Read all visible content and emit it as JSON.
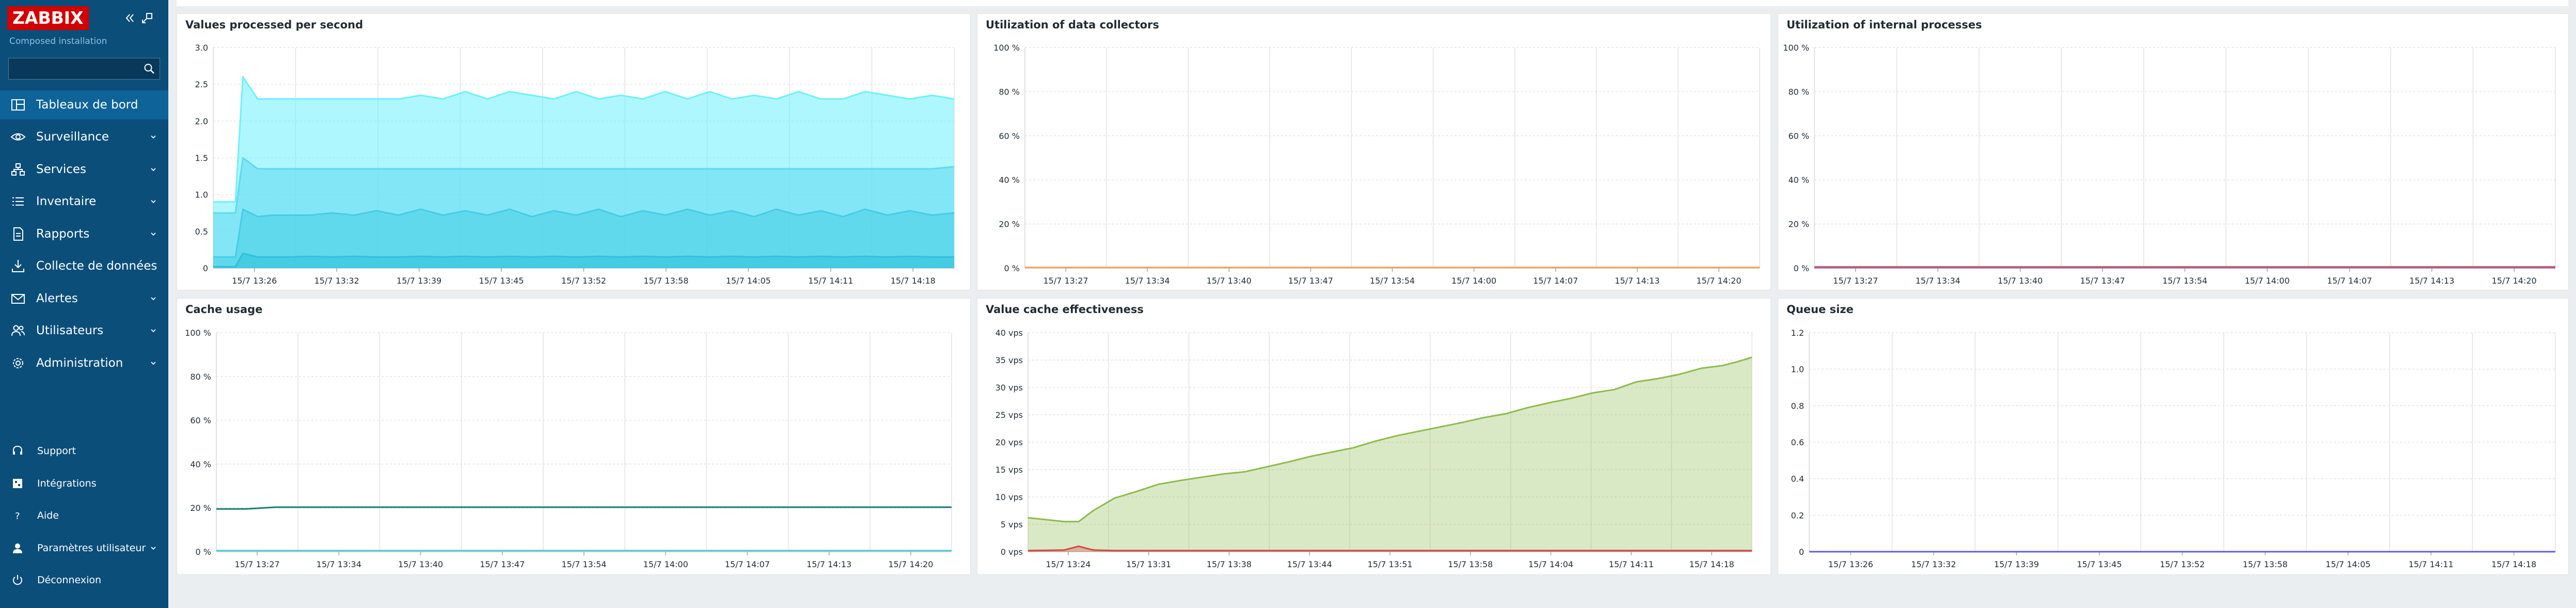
{
  "sidebar": {
    "logo": "ZABBIX",
    "install_label": "Composed installation",
    "search": {
      "placeholder": ""
    },
    "menu": [
      {
        "label": "Tableaux de bord",
        "icon": "dashboard-icon",
        "active": true
      },
      {
        "label": "Surveillance",
        "icon": "eye-icon"
      },
      {
        "label": "Services",
        "icon": "services-icon"
      },
      {
        "label": "Inventaire",
        "icon": "list-icon"
      },
      {
        "label": "Rapports",
        "icon": "report-icon"
      },
      {
        "label": "Collecte de données",
        "icon": "download-icon"
      },
      {
        "label": "Alertes",
        "icon": "mail-icon"
      },
      {
        "label": "Utilisateurs",
        "icon": "users-icon"
      },
      {
        "label": "Administration",
        "icon": "gear-icon"
      }
    ],
    "util": [
      {
        "label": "Support",
        "icon": "headset-icon"
      },
      {
        "label": "Intégrations",
        "icon": "integrations-icon"
      },
      {
        "label": "Aide",
        "icon": "help-icon"
      },
      {
        "label": "Paramètres utilisateur",
        "icon": "user-icon",
        "chevron": true
      },
      {
        "label": "Déconnexion",
        "icon": "power-icon"
      }
    ]
  },
  "widgets": {
    "values_processed": {
      "title": "Values processed per second"
    },
    "data_collectors": {
      "title": "Utilization of data collectors"
    },
    "internal_processes": {
      "title": "Utilization of internal processes"
    },
    "cache_usage": {
      "title": "Cache usage"
    },
    "value_cache": {
      "title": "Value cache effectiveness"
    },
    "queue_size": {
      "title": "Queue size"
    }
  },
  "chart_data": [
    {
      "id": "values_processed",
      "type": "area",
      "title": "Values processed per second",
      "y_ticks": [
        "0",
        "0.5",
        "1.0",
        "1.5",
        "2.0",
        "2.5",
        "3.0"
      ],
      "ylim": [
        0,
        3
      ],
      "x_ticks": [
        "15/7 13:26",
        "15/7 13:32",
        "15/7 13:39",
        "15/7 13:45",
        "15/7 13:52",
        "15/7 13:58",
        "15/7 14:05",
        "15/7 14:11",
        "15/7 14:18"
      ],
      "x": [
        0,
        3,
        4,
        6,
        8,
        10,
        13,
        16,
        19,
        22,
        25,
        28,
        31,
        34,
        37,
        40,
        43,
        46,
        49,
        52,
        55,
        58,
        61,
        64,
        67,
        70,
        73,
        76,
        79,
        82,
        85,
        88,
        91,
        94,
        97,
        100
      ],
      "series": [
        {
          "color": "#6df0ff",
          "values": [
            0.9,
            0.9,
            2.6,
            2.3,
            2.3,
            2.3,
            2.3,
            2.3,
            2.3,
            2.3,
            2.3,
            2.35,
            2.3,
            2.4,
            2.3,
            2.4,
            2.35,
            2.3,
            2.4,
            2.3,
            2.35,
            2.3,
            2.4,
            2.3,
            2.4,
            2.3,
            2.35,
            2.3,
            2.4,
            2.3,
            2.3,
            2.4,
            2.35,
            2.3,
            2.35,
            2.3
          ]
        },
        {
          "color": "#5fd9ee",
          "values": [
            0.75,
            0.75,
            1.5,
            1.35,
            1.35,
            1.35,
            1.35,
            1.35,
            1.35,
            1.35,
            1.35,
            1.35,
            1.35,
            1.35,
            1.35,
            1.35,
            1.35,
            1.35,
            1.35,
            1.35,
            1.35,
            1.35,
            1.35,
            1.35,
            1.35,
            1.35,
            1.35,
            1.35,
            1.35,
            1.35,
            1.35,
            1.35,
            1.35,
            1.35,
            1.35,
            1.38
          ]
        },
        {
          "color": "#45cde6",
          "values": [
            0.15,
            0.15,
            0.8,
            0.7,
            0.72,
            0.72,
            0.72,
            0.75,
            0.72,
            0.78,
            0.72,
            0.8,
            0.72,
            0.78,
            0.72,
            0.8,
            0.7,
            0.78,
            0.72,
            0.8,
            0.7,
            0.78,
            0.72,
            0.8,
            0.72,
            0.78,
            0.7,
            0.8,
            0.72,
            0.78,
            0.7,
            0.8,
            0.72,
            0.78,
            0.72,
            0.75
          ]
        },
        {
          "color": "#2fc0dc",
          "values": [
            0.02,
            0.02,
            0.2,
            0.15,
            0.15,
            0.15,
            0.16,
            0.15,
            0.16,
            0.15,
            0.15,
            0.16,
            0.15,
            0.16,
            0.15,
            0.16,
            0.15,
            0.16,
            0.15,
            0.16,
            0.15,
            0.16,
            0.15,
            0.16,
            0.15,
            0.16,
            0.15,
            0.16,
            0.15,
            0.16,
            0.15,
            0.16,
            0.15,
            0.16,
            0.15,
            0.15
          ]
        }
      ]
    },
    {
      "id": "data_collectors",
      "type": "line",
      "title": "Utilization of data collectors",
      "y_ticks": [
        "0 %",
        "20 %",
        "40 %",
        "60 %",
        "80 %",
        "100 %"
      ],
      "ylim": [
        0,
        100
      ],
      "x_ticks": [
        "15/7 13:27",
        "15/7 13:34",
        "15/7 13:40",
        "15/7 13:47",
        "15/7 13:54",
        "15/7 14:00",
        "15/7 14:07",
        "15/7 14:13",
        "15/7 14:20"
      ],
      "x": [
        0,
        100
      ],
      "series": [
        {
          "color": "#f0a35a",
          "values": [
            0.3,
            0.3
          ]
        }
      ]
    },
    {
      "id": "internal_processes",
      "type": "line",
      "title": "Utilization of internal processes",
      "y_ticks": [
        "0 %",
        "20 %",
        "40 %",
        "60 %",
        "80 %",
        "100 %"
      ],
      "ylim": [
        0,
        100
      ],
      "x_ticks": [
        "15/7 13:27",
        "15/7 13:34",
        "15/7 13:40",
        "15/7 13:47",
        "15/7 13:54",
        "15/7 14:00",
        "15/7 14:07",
        "15/7 14:13",
        "15/7 14:20"
      ],
      "x": [
        0,
        100
      ],
      "series": [
        {
          "color": "#e07a3a",
          "values": [
            0.6,
            0.6
          ]
        },
        {
          "color": "#9b59b6",
          "values": [
            0.2,
            0.2
          ]
        }
      ]
    },
    {
      "id": "cache_usage",
      "type": "line",
      "title": "Cache usage",
      "y_ticks": [
        "0 %",
        "20 %",
        "40 %",
        "60 %",
        "80 %",
        "100 %"
      ],
      "ylim": [
        0,
        100
      ],
      "x_ticks": [
        "15/7 13:27",
        "15/7 13:34",
        "15/7 13:40",
        "15/7 13:47",
        "15/7 13:54",
        "15/7 14:00",
        "15/7 14:07",
        "15/7 14:13",
        "15/7 14:20"
      ],
      "x": [
        0,
        4,
        8,
        100
      ],
      "series": [
        {
          "color": "#1a7a73",
          "values": [
            19.5,
            19.5,
            20.3,
            20.3
          ]
        },
        {
          "color": "#4fd1e0",
          "values": [
            0.5,
            0.5,
            0.5,
            0.5
          ]
        }
      ]
    },
    {
      "id": "value_cache",
      "type": "area",
      "title": "Value cache effectiveness",
      "y_ticks": [
        "0 vps",
        "5 vps",
        "10 vps",
        "15 vps",
        "20 vps",
        "25 vps",
        "30 vps",
        "35 vps",
        "40 vps"
      ],
      "ylim": [
        0,
        40
      ],
      "x_ticks": [
        "15/7 13:24",
        "15/7 13:31",
        "15/7 13:38",
        "15/7 13:44",
        "15/7 13:51",
        "15/7 13:58",
        "15/7 14:04",
        "15/7 14:11",
        "15/7 14:18"
      ],
      "x": [
        0,
        5,
        7,
        9,
        12,
        15,
        18,
        21,
        24,
        27,
        30,
        33,
        36,
        39,
        42,
        45,
        48,
        51,
        54,
        57,
        60,
        63,
        66,
        69,
        72,
        75,
        78,
        81,
        84,
        87,
        90,
        93,
        96,
        98,
        100
      ],
      "series": [
        {
          "color": "#8cbb4b",
          "values": [
            6.2,
            5.5,
            5.5,
            7.5,
            9.8,
            11.0,
            12.3,
            13.0,
            13.6,
            14.2,
            14.6,
            15.5,
            16.4,
            17.4,
            18.2,
            19.0,
            20.2,
            21.2,
            22.0,
            22.8,
            23.6,
            24.5,
            25.2,
            26.3,
            27.2,
            28.0,
            29.0,
            29.6,
            31.0,
            31.6,
            32.4,
            33.5,
            34.0,
            34.7,
            35.5
          ]
        },
        {
          "color": "#d64545",
          "values": [
            0.2,
            0.3,
            1.0,
            0.3,
            0.2,
            0.2,
            0.2,
            0.2,
            0.2,
            0.2,
            0.2,
            0.2,
            0.2,
            0.2,
            0.2,
            0.2,
            0.2,
            0.2,
            0.2,
            0.2,
            0.2,
            0.2,
            0.2,
            0.2,
            0.2,
            0.2,
            0.2,
            0.2,
            0.2,
            0.2,
            0.2,
            0.2,
            0.2,
            0.2,
            0.2
          ]
        }
      ]
    },
    {
      "id": "queue_size",
      "type": "line",
      "title": "Queue size",
      "y_ticks": [
        "0",
        "0.2",
        "0.4",
        "0.6",
        "0.8",
        "1.0",
        "1.2"
      ],
      "ylim": [
        0,
        1.2
      ],
      "x_ticks": [
        "15/7 13:26",
        "15/7 13:32",
        "15/7 13:39",
        "15/7 13:45",
        "15/7 13:52",
        "15/7 13:58",
        "15/7 14:05",
        "15/7 14:11",
        "15/7 14:18"
      ],
      "x": [
        0,
        100
      ],
      "series": [
        {
          "color": "#5a5fd6",
          "values": [
            0,
            0
          ]
        }
      ]
    }
  ]
}
